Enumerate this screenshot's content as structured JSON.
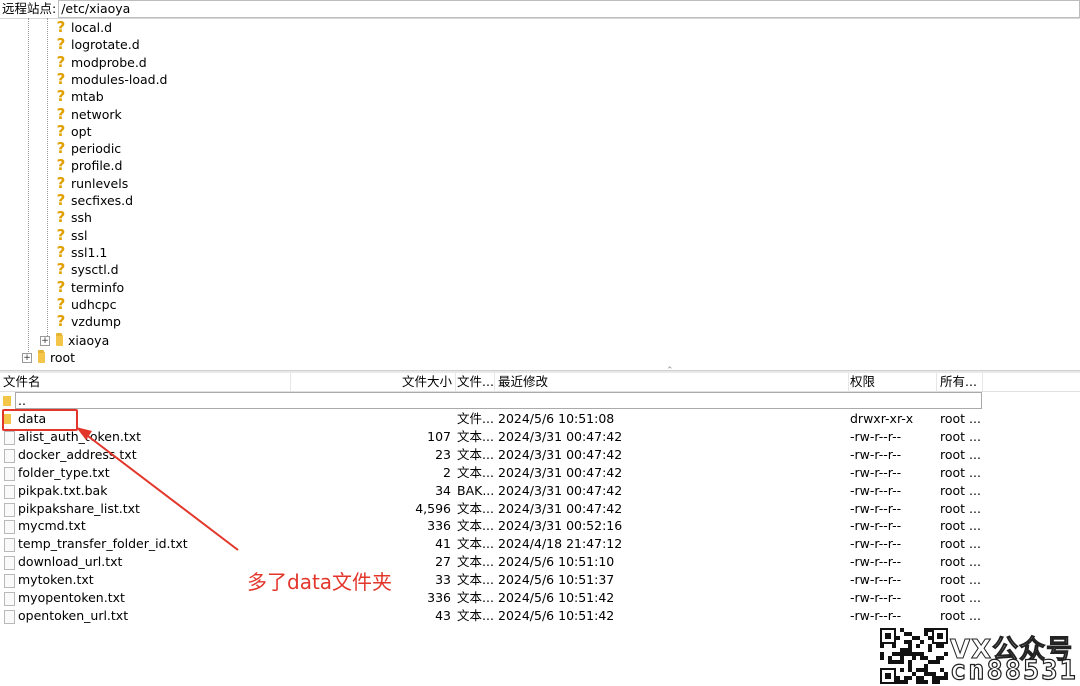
{
  "site_bar": {
    "label": "远程站点:",
    "path": "/etc/xiaoya"
  },
  "tree": {
    "items": [
      "local.d",
      "logrotate.d",
      "modprobe.d",
      "modules-load.d",
      "mtab",
      "network",
      "opt",
      "periodic",
      "profile.d",
      "runlevels",
      "secfixes.d",
      "ssh",
      "ssl",
      "ssl1.1",
      "sysctl.d",
      "terminfo",
      "udhcpc",
      "vzdump"
    ],
    "xiaoya": "xiaoya",
    "root": "root",
    "expander_glyph": "+"
  },
  "list": {
    "headers": {
      "name": "文件名",
      "size": "文件大小",
      "type": "文件...",
      "modified": "最近修改",
      "perms": "权限",
      "owner": "所有..."
    },
    "parent": "..",
    "rows": [
      {
        "name": "data",
        "size": "",
        "type": "文件...",
        "modified": "2024/5/6 10:51:08",
        "perms": "drwxr-xr-x",
        "owner": "root ...",
        "folder": true
      },
      {
        "name": "alist_auth_token.txt",
        "size": "107",
        "type": "文本...",
        "modified": "2024/3/31 00:47:42",
        "perms": "-rw-r--r--",
        "owner": "root ..."
      },
      {
        "name": "docker_address.txt",
        "size": "23",
        "type": "文本...",
        "modified": "2024/3/31 00:47:42",
        "perms": "-rw-r--r--",
        "owner": "root ..."
      },
      {
        "name": "folder_type.txt",
        "size": "2",
        "type": "文本...",
        "modified": "2024/3/31 00:47:42",
        "perms": "-rw-r--r--",
        "owner": "root ..."
      },
      {
        "name": "pikpak.txt.bak",
        "size": "34",
        "type": "BAK...",
        "modified": "2024/3/31 00:47:42",
        "perms": "-rw-r--r--",
        "owner": "root ..."
      },
      {
        "name": "pikpakshare_list.txt",
        "size": "4,596",
        "type": "文本...",
        "modified": "2024/3/31 00:47:42",
        "perms": "-rw-r--r--",
        "owner": "root ..."
      },
      {
        "name": "mycmd.txt",
        "size": "336",
        "type": "文本...",
        "modified": "2024/3/31 00:52:16",
        "perms": "-rw-r--r--",
        "owner": "root ..."
      },
      {
        "name": "temp_transfer_folder_id.txt",
        "size": "41",
        "type": "文本...",
        "modified": "2024/4/18 21:47:12",
        "perms": "-rw-r--r--",
        "owner": "root ..."
      },
      {
        "name": "download_url.txt",
        "size": "27",
        "type": "文本...",
        "modified": "2024/5/6 10:51:10",
        "perms": "-rw-r--r--",
        "owner": "root ..."
      },
      {
        "name": "mytoken.txt",
        "size": "33",
        "type": "文本...",
        "modified": "2024/5/6 10:51:37",
        "perms": "-rw-r--r--",
        "owner": "root ..."
      },
      {
        "name": "myopentoken.txt",
        "size": "336",
        "type": "文本...",
        "modified": "2024/5/6 10:51:42",
        "perms": "-rw-r--r--",
        "owner": "root ..."
      },
      {
        "name": "opentoken_url.txt",
        "size": "43",
        "type": "文本...",
        "modified": "2024/5/6 10:51:42",
        "perms": "-rw-r--r--",
        "owner": "root ..."
      }
    ]
  },
  "annotation": {
    "text": "多了data文件夹",
    "color": "#e3362b"
  },
  "watermark": {
    "line1": "VX公众号",
    "line2": "cn88531"
  },
  "icons": {
    "unknown_folder": "question-mark-icon",
    "folder": "folder-icon",
    "file": "file-icon",
    "qr": "qr-code-icon"
  }
}
